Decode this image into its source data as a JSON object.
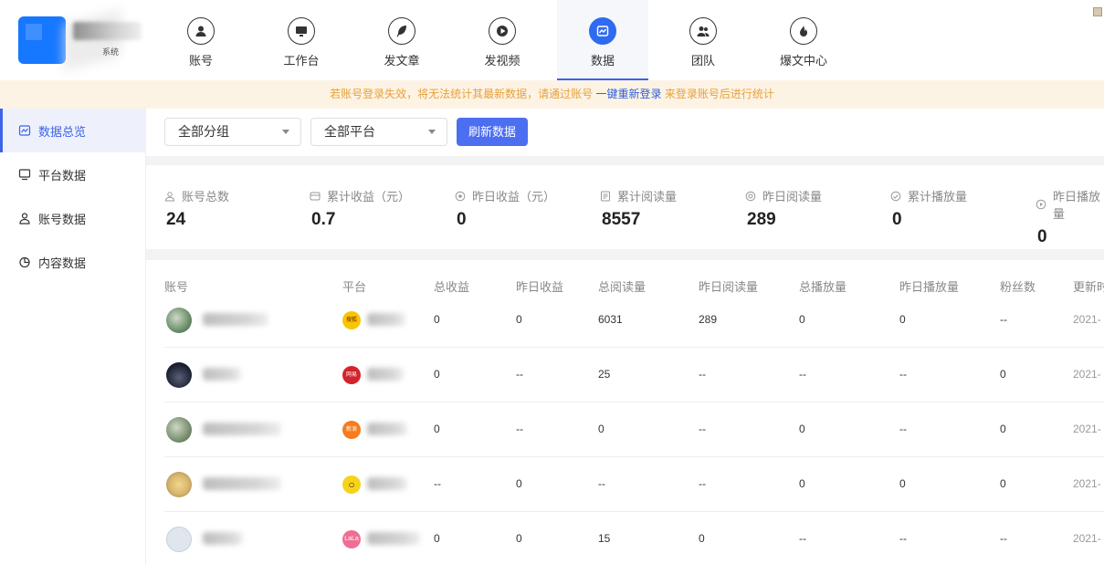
{
  "app": {
    "logo_subtitle": "系统"
  },
  "nav": {
    "items": [
      {
        "label": "账号",
        "icon": "user-icon"
      },
      {
        "label": "工作台",
        "icon": "monitor-icon"
      },
      {
        "label": "发文章",
        "icon": "feather-icon"
      },
      {
        "label": "发视频",
        "icon": "play-icon"
      },
      {
        "label": "数据",
        "icon": "chart-icon",
        "active": true
      },
      {
        "label": "团队",
        "icon": "team-icon"
      },
      {
        "label": "爆文中心",
        "icon": "flame-icon"
      }
    ]
  },
  "notice": {
    "before": "若账号登录失效，将无法统计其最新数据，请通过账号",
    "link": "一键重新登录",
    "after": "来登录账号后进行统计"
  },
  "sidebar": {
    "items": [
      {
        "label": "数据总览",
        "icon": "chart-icon",
        "active": true
      },
      {
        "label": "平台数据",
        "icon": "monitor-icon"
      },
      {
        "label": "账号数据",
        "icon": "user-icon"
      },
      {
        "label": "内容数据",
        "icon": "pie-icon"
      }
    ]
  },
  "filters": {
    "group": "全部分组",
    "platform": "全部平台",
    "refresh_label": "刷新数据"
  },
  "stats": [
    {
      "label": "账号总数",
      "value": "24",
      "icon": "user-icon"
    },
    {
      "label": "累计收益（元）",
      "value": "0.7",
      "icon": "wallet-icon"
    },
    {
      "label": "昨日收益（元）",
      "value": "0",
      "icon": "coin-icon"
    },
    {
      "label": "累计阅读量",
      "value": "8557",
      "icon": "doc-icon"
    },
    {
      "label": "昨日阅读量",
      "value": "289",
      "icon": "eye-icon"
    },
    {
      "label": "累计播放量",
      "value": "0",
      "icon": "play-circle-icon"
    },
    {
      "label": "昨日播放量",
      "value": "0",
      "icon": "play-circle-icon"
    }
  ],
  "table": {
    "headers": [
      "账号",
      "平台",
      "总收益",
      "昨日收益",
      "总阅读量",
      "昨日阅读量",
      "总播放量",
      "昨日播放量",
      "粉丝数",
      "更新时"
    ],
    "rows": [
      {
        "total_income": "0",
        "yesterday_income": "0",
        "total_reads": "6031",
        "yesterday_reads": "289",
        "total_plays": "0",
        "yesterday_plays": "0",
        "fans": "--",
        "updated": "2021-",
        "avatar_color": "#6b8f6a",
        "platform_color": "#f7c600",
        "platform_text": "搜狐"
      },
      {
        "total_income": "0",
        "yesterday_income": "--",
        "total_reads": "25",
        "yesterday_reads": "--",
        "total_plays": "--",
        "yesterday_plays": "--",
        "fans": "0",
        "updated": "2021-",
        "avatar_color": "#1b2030",
        "platform_color": "#d4232c",
        "platform_text": "网易"
      },
      {
        "total_income": "0",
        "yesterday_income": "--",
        "total_reads": "0",
        "yesterday_reads": "--",
        "total_plays": "0",
        "yesterday_plays": "--",
        "fans": "0",
        "updated": "2021-",
        "avatar_color": "#7a8f70",
        "platform_color": "#f57c1f",
        "platform_text": "新浪"
      },
      {
        "total_income": "--",
        "yesterday_income": "0",
        "total_reads": "--",
        "yesterday_reads": "--",
        "total_plays": "0",
        "yesterday_plays": "0",
        "fans": "0",
        "updated": "2021-",
        "avatar_color": "#d8b46a",
        "platform_color": "#f6d31a",
        "platform_text": "○"
      },
      {
        "total_income": "0",
        "yesterday_income": "0",
        "total_reads": "15",
        "yesterday_reads": "0",
        "total_plays": "--",
        "yesterday_plays": "--",
        "fans": "--",
        "updated": "2021-",
        "avatar_color": "#dfe6ee",
        "platform_color": "#ee6f93",
        "platform_text": "LaLa"
      }
    ]
  },
  "colors": {
    "accent": "#3b64e8",
    "button": "#4c6ef0",
    "notice_bg": "#fdf3e4",
    "notice_text": "#e6a23c"
  }
}
